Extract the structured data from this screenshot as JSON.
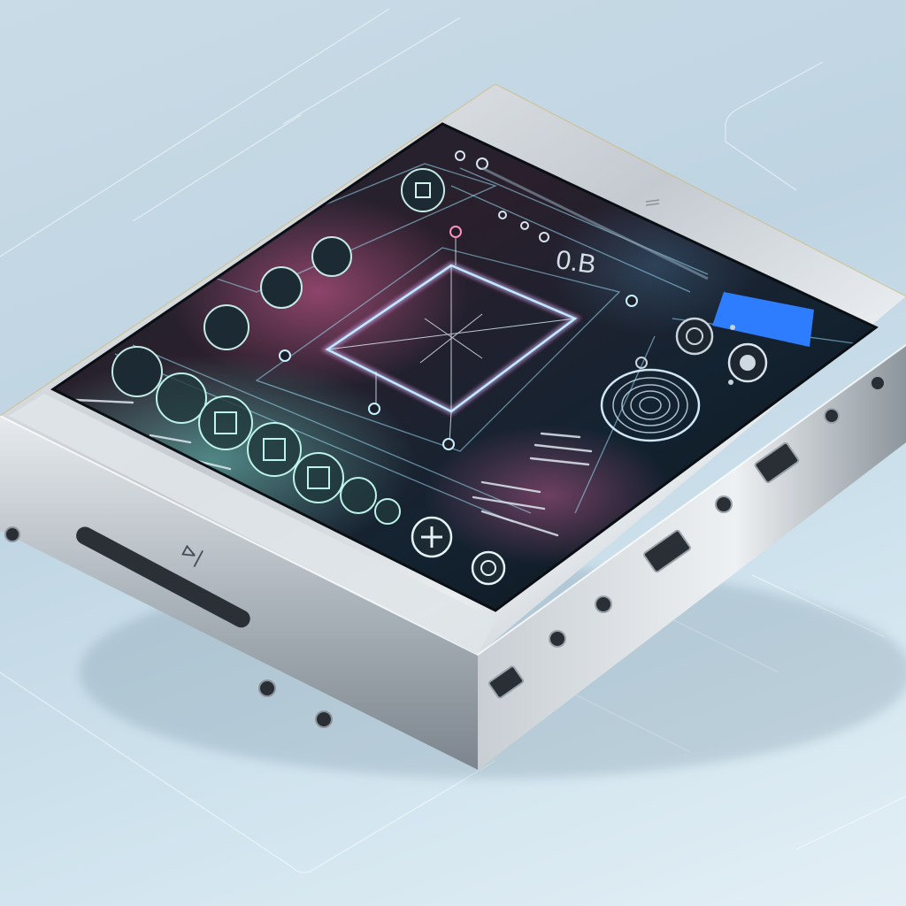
{
  "screen": {
    "readout": "0.B",
    "accent_badge": "",
    "theme": {
      "glow_pink": "#ff5fa2",
      "glow_blue": "#4fb8ff",
      "glow_teal": "#5fe3d0",
      "accent_blue": "#2f7dff",
      "panel_dark": "#0d1620"
    }
  },
  "device": {
    "bezel_mark": "⊳|",
    "finish": "brushed-silver"
  },
  "icons": {
    "top_left": "app-icon",
    "left_column": [
      "media-icon",
      "image-icon",
      "grid-icon",
      "camera-icon"
    ],
    "bottom_row": [
      "photo-icon",
      "window-icon",
      "frame-icon",
      "gallery-icon",
      "tile-icon",
      "dot-icon"
    ],
    "add": "plus-icon",
    "settings": "gear-icon",
    "dial": "fingerprint-dial-icon"
  }
}
